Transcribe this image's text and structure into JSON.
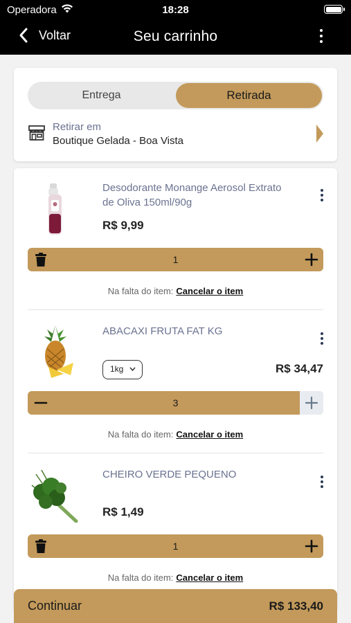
{
  "status_bar": {
    "carrier": "Operadora",
    "time": "18:28"
  },
  "header": {
    "back_label": "Voltar",
    "title": "Seu carrinho"
  },
  "delivery": {
    "options": [
      "Entrega",
      "Retirada"
    ],
    "selected": "Retirada",
    "pickup_label": "Retirar em",
    "pickup_store": "Boutique Gelada - Boa Vista"
  },
  "items": [
    {
      "name": "Desodorante Monange Aerosol Extrato de Oliva 150ml/90g",
      "price": "R$ 9,99",
      "quantity": "1",
      "shortage_label": "Na falta do item:",
      "shortage_action": "Cancelar o item"
    },
    {
      "name": "ABACAXI FRUTA FAT KG",
      "weight": "1kg",
      "price": "R$ 34,47",
      "quantity": "3",
      "shortage_label": "Na falta do item:",
      "shortage_action": "Cancelar o item"
    },
    {
      "name": "CHEIRO VERDE PEQUENO",
      "price": "R$ 1,49",
      "quantity": "1",
      "shortage_label": "Na falta do item:",
      "shortage_action": "Cancelar o item"
    }
  ],
  "footer": {
    "continue_label": "Continuar",
    "total": "R$ 133,40"
  },
  "colors": {
    "accent": "#c39a5b",
    "header_bg": "#000000",
    "muted_text": "#6a7290"
  },
  "icons": [
    "wifi-icon",
    "battery-icon",
    "chevron-left-icon",
    "kebab-icon",
    "store-icon",
    "arrow-right-icon",
    "trash-icon",
    "plus-icon",
    "minus-icon",
    "chevron-down-icon"
  ]
}
